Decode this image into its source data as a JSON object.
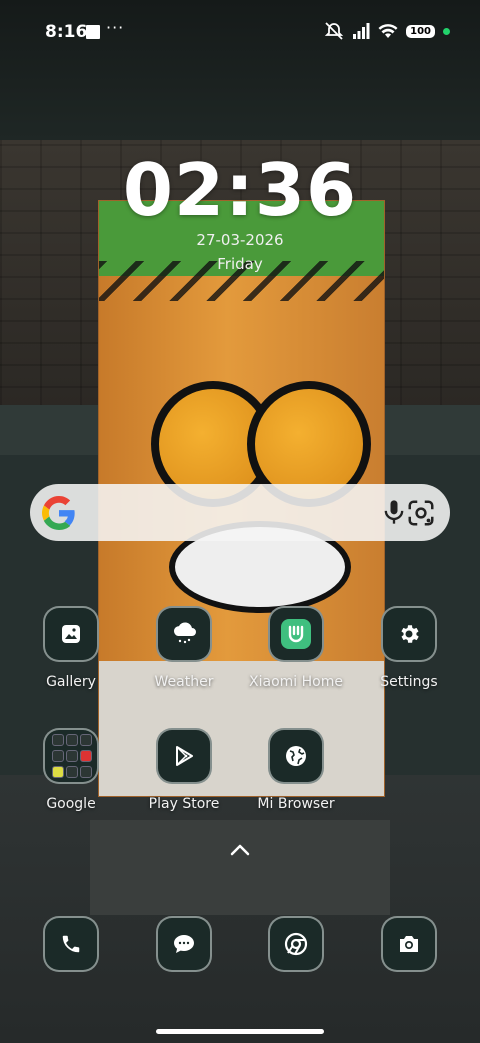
{
  "status_bar": {
    "time": "8:16",
    "more": "···",
    "battery": "100"
  },
  "clock_widget": {
    "time": "02:36",
    "date": "27-03-2026",
    "day": "Friday"
  },
  "search": {},
  "apps_row1": [
    {
      "label": "Gallery",
      "icon": "gallery-icon"
    },
    {
      "label": "Weather",
      "icon": "weather-icon"
    },
    {
      "label": "Xiaomi Home",
      "icon": "xiaomi-home-icon"
    },
    {
      "label": "Settings",
      "icon": "gear-icon"
    }
  ],
  "apps_row2": [
    {
      "label": "Google",
      "icon": "google-folder-icon"
    },
    {
      "label": "Play Store",
      "icon": "play-store-icon"
    },
    {
      "label": "Mi Browser",
      "icon": "globe-icon"
    }
  ],
  "dock": [
    {
      "icon": "phone-icon"
    },
    {
      "icon": "messages-icon"
    },
    {
      "icon": "chrome-icon"
    },
    {
      "icon": "camera-icon"
    }
  ],
  "colors": {
    "xiaomi_home": "#3fbf7f",
    "status_dot": "#22d36b"
  }
}
